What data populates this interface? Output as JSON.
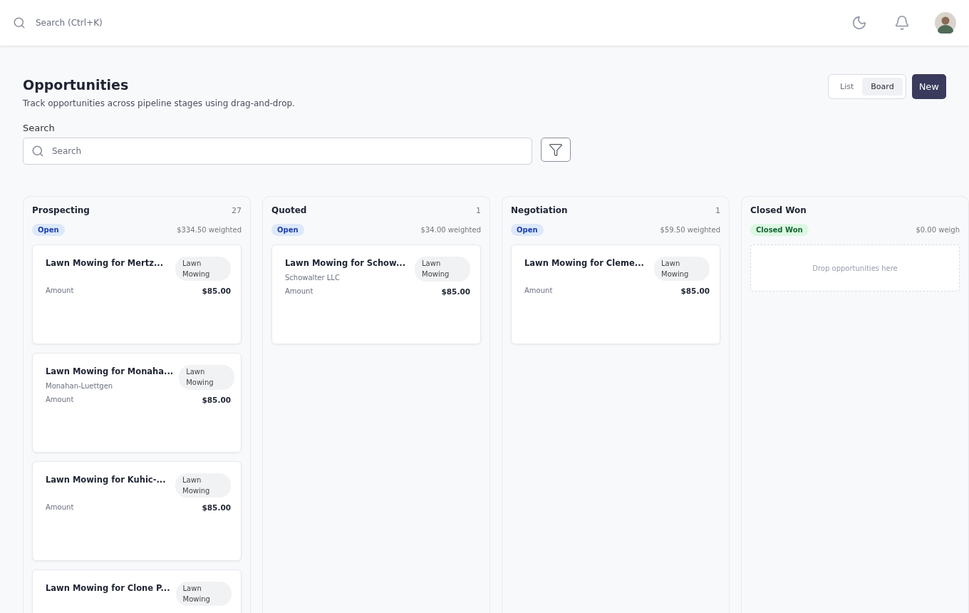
{
  "topbar": {
    "search_placeholder": "Search (Ctrl+K)"
  },
  "header": {
    "title": "Opportunities",
    "subtitle": "Track opportunities across pipeline stages using drag-and-drop.",
    "views": [
      {
        "label": "List",
        "selected": false
      },
      {
        "label": "Board",
        "selected": true
      }
    ],
    "new_button": "New"
  },
  "search": {
    "label": "Search",
    "placeholder": "Search"
  },
  "columns": [
    {
      "name": "Prospecting",
      "count": "27",
      "status": {
        "label": "Open",
        "kind": "open"
      },
      "weighted": "$334.50 weighted",
      "cards": [
        {
          "title": "Lawn Mowing for Mertz...",
          "tag": "Lawn Mowing",
          "amount_label": "Amount",
          "amount": "$85.00"
        },
        {
          "title": "Lawn Mowing for Monaha...",
          "company": "Monahan-Luettgen",
          "tag": "Lawn Mowing",
          "amount_label": "Amount",
          "amount": "$85.00"
        },
        {
          "title": "Lawn Mowing for Kuhic-...",
          "tag": "Lawn Mowing",
          "amount_label": "Amount",
          "amount": "$85.00"
        },
        {
          "title": "Lawn Mowing for Clone P...",
          "tag": "Lawn Mowing"
        }
      ]
    },
    {
      "name": "Quoted",
      "count": "1",
      "status": {
        "label": "Open",
        "kind": "open"
      },
      "weighted": "$34.00 weighted",
      "cards": [
        {
          "title": "Lawn Mowing for Schow...",
          "company": "Schowalter LLC",
          "tag": "Lawn Mowing",
          "amount_label": "Amount",
          "amount": "$85.00"
        }
      ]
    },
    {
      "name": "Negotiation",
      "count": "1",
      "status": {
        "label": "Open",
        "kind": "open"
      },
      "weighted": "$59.50 weighted",
      "cards": [
        {
          "title": "Lawn Mowing for Cleme...",
          "tag": "Lawn Mowing",
          "amount_label": "Amount",
          "amount": "$85.00"
        }
      ]
    },
    {
      "name": "Closed Won",
      "status": {
        "label": "Closed Won",
        "kind": "won"
      },
      "weighted": "$0.00 weigh",
      "empty_text": "Drop opportunities here"
    }
  ]
}
